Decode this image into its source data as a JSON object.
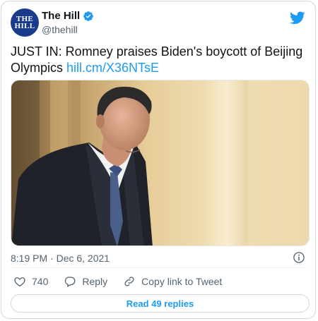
{
  "author": {
    "display_name": "The Hill",
    "handle": "@thehill",
    "avatar_text_top": "THE",
    "avatar_text_bottom": "HILL",
    "verified": true
  },
  "tweet": {
    "text": "JUST IN: Romney praises Biden's boycott of Beijing Olympics ",
    "link": "hill.cm/X36NTsE",
    "timestamp": "8:19 PM · Dec 6, 2021"
  },
  "actions": {
    "likes": "740",
    "reply_label": "Reply",
    "copy_label": "Copy link to Tweet"
  },
  "replies_button": "Read 49 replies",
  "colors": {
    "accent": "#1d9bf0",
    "secondary_text": "#536471",
    "border": "#cfd9de"
  },
  "icons": [
    "verified-icon",
    "twitter-bird-icon",
    "info-icon",
    "heart-icon",
    "reply-icon",
    "link-icon"
  ]
}
